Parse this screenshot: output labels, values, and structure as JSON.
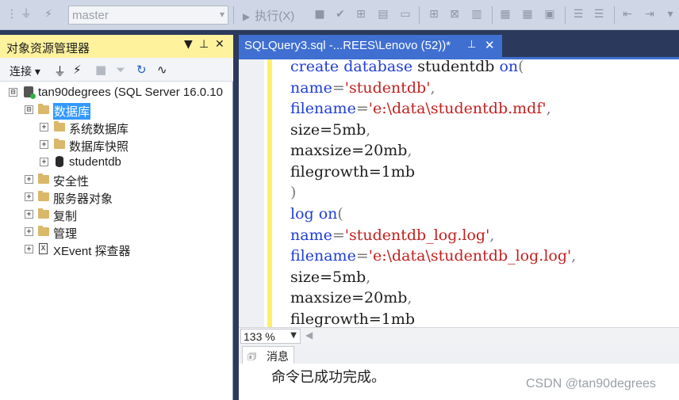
{
  "toolbar": {
    "database": "master",
    "execute_label": "执行(X)"
  },
  "object_explorer": {
    "title": "对象资源管理器",
    "pin_glyph": "▼",
    "connect_label": "连接",
    "tree": [
      {
        "label": "tan90degrees (SQL Server 16.0.10",
        "expander": "⊟"
      },
      {
        "label": "数据库",
        "expander": "⊟"
      },
      {
        "label": "系统数据库",
        "expander": "+"
      },
      {
        "label": "数据库快照",
        "expander": "+"
      },
      {
        "label": "studentdb",
        "expander": "+"
      },
      {
        "label": "安全性",
        "expander": "+"
      },
      {
        "label": "服务器对象",
        "expander": "+"
      },
      {
        "label": "复制",
        "expander": "+"
      },
      {
        "label": "管理",
        "expander": "+"
      },
      {
        "label": "XEvent 探查器",
        "expander": "+"
      }
    ]
  },
  "editor": {
    "tab_title": "SQLQuery3.sql -...REES\\Lenovo (52))*",
    "code": [
      {
        "a": "create database ",
        "b": "studentdb ",
        "c": "on",
        "d": "("
      },
      {
        "a": "name",
        "b": "=",
        "c": "'studentdb'",
        "d": ","
      },
      {
        "a": "filename",
        "b": "=",
        "c": "'e:\\data\\studentdb.mdf'",
        "d": ","
      },
      {
        "a": "size=5mb",
        "b": ",",
        "c": "",
        "d": ""
      },
      {
        "a": "maxsize=20mb",
        "b": ",",
        "c": "",
        "d": ""
      },
      {
        "a": "filegrowth=1mb",
        "b": "",
        "c": "",
        "d": ""
      },
      {
        "a": ")",
        "b": "",
        "c": "",
        "d": ""
      },
      {
        "a": "log ",
        "b": "on",
        "c": "(",
        "d": ""
      },
      {
        "a": "name",
        "b": "=",
        "c": "'studentdb_log.log'",
        "d": ","
      },
      {
        "a": "filename",
        "b": "=",
        "c": "'e:\\data\\studentdb_log.log'",
        "d": ","
      },
      {
        "a": "size=5mb",
        "b": ",",
        "c": "",
        "d": ""
      },
      {
        "a": "maxsize=20mb",
        "b": ",",
        "c": "",
        "d": ""
      },
      {
        "a": "filegrowth=1mb",
        "b": "",
        "c": "",
        "d": ""
      }
    ],
    "zoom": "133 %"
  },
  "results": {
    "tab_label": "消息",
    "message": "命令已成功完成。"
  },
  "watermark": "CSDN @tan90degrees",
  "colors": {
    "selection": "#3399ff",
    "keyword": "#1f3ed6",
    "string": "#c2201f",
    "doc_tab": "#3f6fd1",
    "panel_title": "#fff29d"
  }
}
